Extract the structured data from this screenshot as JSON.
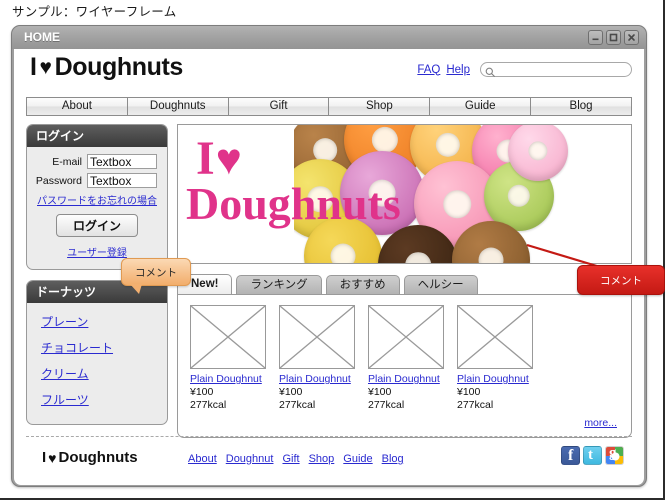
{
  "caption": "サンプル：ワイヤーフレーム",
  "window": {
    "title": "HOME",
    "controls": [
      {
        "name": "minimize-button",
        "glyph": "minimize"
      },
      {
        "name": "maximize-button",
        "glyph": "maximize"
      },
      {
        "name": "close-button",
        "glyph": "close"
      }
    ]
  },
  "header": {
    "logo_i": "I",
    "logo_heart": "♥",
    "logo_text": "Doughnuts",
    "util_links": [
      {
        "label": "FAQ"
      },
      {
        "label": "Help"
      }
    ],
    "search": {
      "value": "",
      "placeholder": "",
      "icon": "search-icon"
    }
  },
  "global_nav": [
    {
      "label": "About"
    },
    {
      "label": "Doughnuts"
    },
    {
      "label": "Gift"
    },
    {
      "label": "Shop"
    },
    {
      "label": "Guide"
    },
    {
      "label": "Blog"
    }
  ],
  "login_panel": {
    "title": "ログイン",
    "email_label": "E-mail",
    "email_value": "Textbox",
    "password_label": "Password",
    "password_value": "Textbox",
    "forgot_link": "パスワードをお忘れの場合",
    "submit_label": "ログイン",
    "register_link": "ユーザー登録"
  },
  "category_panel": {
    "title": "ドーナッツ",
    "items": [
      {
        "label": "プレーン"
      },
      {
        "label": "チョコレート"
      },
      {
        "label": "クリーム"
      },
      {
        "label": "フルーツ"
      }
    ]
  },
  "hero": {
    "line1_i": "I",
    "line1_heart": "♥",
    "line2": "Doughnuts",
    "text_color": "#e0338a",
    "alt": "doughnuts-photo"
  },
  "tabs": [
    {
      "label": "New!",
      "active": true
    },
    {
      "label": "ランキング",
      "active": false
    },
    {
      "label": "おすすめ",
      "active": false
    },
    {
      "label": "ヘルシー",
      "active": false
    }
  ],
  "products": [
    {
      "name": "Plain Doughnut",
      "price": "¥100",
      "kcal": "277kcal"
    },
    {
      "name": "Plain Doughnut",
      "price": "¥100",
      "kcal": "277kcal"
    },
    {
      "name": "Plain Doughnut",
      "price": "¥100",
      "kcal": "277kcal"
    },
    {
      "name": "Plain Doughnut",
      "price": "¥100",
      "kcal": "277kcal"
    }
  ],
  "more_link": "more...",
  "footer": {
    "logo_i": "I",
    "logo_heart": "♥",
    "logo_text": "Doughnuts",
    "links": [
      {
        "label": "About"
      },
      {
        "label": "Doughnut"
      },
      {
        "label": "Gift"
      },
      {
        "label": "Shop"
      },
      {
        "label": "Guide"
      },
      {
        "label": "Blog"
      }
    ],
    "socials": [
      {
        "name": "facebook-icon",
        "glyph": "f",
        "color": "#3b5998"
      },
      {
        "name": "twitter-icon",
        "glyph": "t",
        "color": "#3fb9e0"
      },
      {
        "name": "googleplus-icon",
        "glyph": "g",
        "color": "#dd4b39"
      }
    ]
  },
  "callouts": {
    "orange": {
      "label": "コメント",
      "color": "#f2ad6b"
    },
    "red": {
      "label": "コメント",
      "color": "#c41a14"
    }
  }
}
